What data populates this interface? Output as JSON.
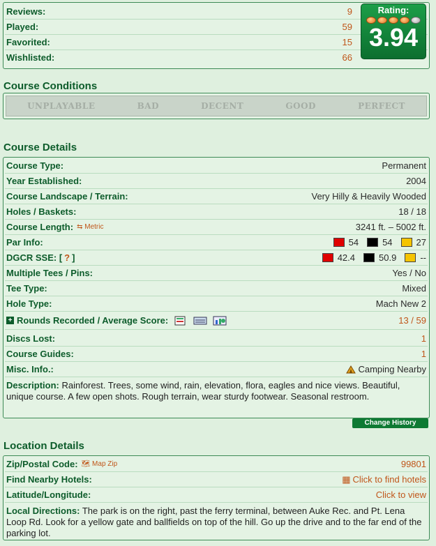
{
  "stats": [
    {
      "label": "Reviews:",
      "value": "9"
    },
    {
      "label": "Played:",
      "value": "59"
    },
    {
      "label": "Favorited:",
      "value": "15"
    },
    {
      "label": "Wishlisted:",
      "value": "66"
    }
  ],
  "rating": {
    "label": "Rating:",
    "value": "3.94",
    "score": 3.94,
    "max": 5
  },
  "conditions": {
    "title": "Course Conditions",
    "levels": [
      "UNPLAYABLE",
      "BAD",
      "DECENT",
      "GOOD",
      "PERFECT"
    ]
  },
  "details": {
    "title": "Course Details",
    "course_type": {
      "label": "Course Type:",
      "value": "Permanent"
    },
    "year": {
      "label": "Year Established:",
      "value": "2004"
    },
    "landscape": {
      "label": "Course Landscape / Terrain:",
      "value": "Very Hilly & Heavily Wooded"
    },
    "holes": {
      "label": "Holes / Baskets:",
      "value": "18 / 18"
    },
    "length": {
      "label": "Course Length:",
      "link": "Metric",
      "value": "3241 ft. – 5002 ft."
    },
    "par": {
      "label": "Par Info:",
      "red": "54",
      "black": "54",
      "gold": "27"
    },
    "sse": {
      "label": "DGCR SSE: [",
      "help": "?",
      "label_end": "]",
      "red": "42.4",
      "black": "50.9",
      "gold": "--"
    },
    "tees": {
      "label": "Multiple Tees / Pins:",
      "value": "Yes / No"
    },
    "tee_type": {
      "label": "Tee Type:",
      "value": "Mixed"
    },
    "hole_type": {
      "label": "Hole Type:",
      "value": "Mach New 2"
    },
    "rounds": {
      "label": "Rounds Recorded / Average Score:",
      "value": "13 / 59"
    },
    "discs_lost": {
      "label": "Discs Lost:",
      "value": "1"
    },
    "guides": {
      "label": "Course Guides:",
      "value": "1"
    },
    "misc": {
      "label": "Misc. Info.:",
      "value": "Camping Nearby"
    },
    "description": {
      "label": "Description:",
      "text": "Rainforest. Trees, some wind, rain, elevation, flora, eagles and nice views. Beautiful, unique course. A few open shots. Rough terrain, wear sturdy footwear. Seasonal restroom."
    },
    "change_history": "Change History"
  },
  "location": {
    "title": "Location Details",
    "zip": {
      "label": "Zip/Postal Code:",
      "link": "Map Zip",
      "value": "99801"
    },
    "hotels": {
      "label": "Find Nearby Hotels:",
      "value": "Click to find hotels"
    },
    "latlng": {
      "label": "Latitude/Longitude:",
      "value": "Click to view"
    },
    "directions": {
      "label": "Local Directions:",
      "text": "The park is on the right, past the ferry terminal, between Auke Rec. and Pt. Lena Loop Rd. Look for a yellow gate and ballfields on top of the hill. Go up the drive and to the far end of the parking lot."
    }
  },
  "colors": {
    "brand_green": "#0d5c2b",
    "accent_orange": "#c0561a",
    "tee_red": "#e00000",
    "tee_black": "#000000",
    "tee_gold": "#f5c400"
  }
}
